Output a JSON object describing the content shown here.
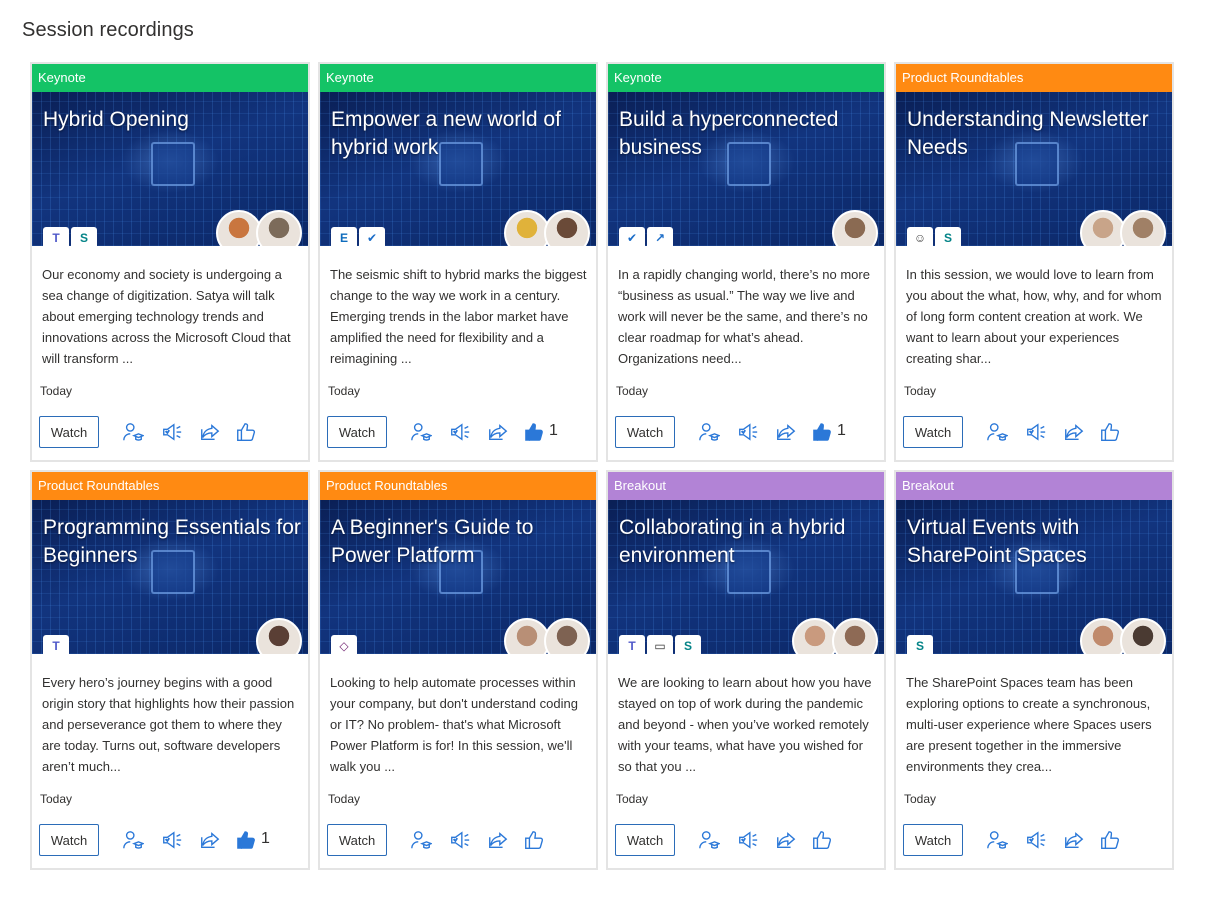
{
  "page": {
    "title": "Session recordings"
  },
  "colors": {
    "keynote": "#14c366",
    "product_roundtables": "#ff8a12",
    "breakout": "#b283d6",
    "action_icon": "#2b78d8"
  },
  "cards": [
    {
      "category": "Keynote",
      "category_color": "#14c366",
      "title": "Hybrid Opening",
      "apps": [
        {
          "icon": "teams-icon",
          "glyph": "T",
          "color": "#5059c9"
        },
        {
          "icon": "sharepoint-icon",
          "glyph": "S",
          "color": "#038387"
        }
      ],
      "avatars": [
        {
          "icon": "speaker-avatar",
          "color": "#c9763f"
        },
        {
          "icon": "speaker-avatar",
          "color": "#7c6b5a"
        }
      ],
      "description": "Our economy and society is undergoing a sea change of digitization. Satya will talk about emerging technology trends and innovations across the Microsoft Cloud that will transform ...",
      "date": "Today",
      "watch_label": "Watch",
      "liked": false,
      "like_count": ""
    },
    {
      "category": "Keynote",
      "category_color": "#14c366",
      "title": "Empower a new world of hybrid work",
      "apps": [
        {
          "icon": "exchange-icon",
          "glyph": "E",
          "color": "#0f6cbd"
        },
        {
          "icon": "planner-icon",
          "glyph": "✔",
          "color": "#1b6dc8"
        }
      ],
      "avatars": [
        {
          "icon": "speaker-avatar",
          "color": "#e0b23a"
        },
        {
          "icon": "speaker-avatar",
          "color": "#6a4a38"
        }
      ],
      "description": "The seismic shift to hybrid marks the biggest change to the way we work in a century. Emerging trends in the labor market have amplified the need for flexibility and a reimagining ...",
      "date": "Today",
      "watch_label": "Watch",
      "liked": true,
      "like_count": "1"
    },
    {
      "category": "Keynote",
      "category_color": "#14c366",
      "title": "Build a hyperconnected business",
      "apps": [
        {
          "icon": "planner-icon",
          "glyph": "✔",
          "color": "#1b6dc8"
        },
        {
          "icon": "analytics-icon",
          "glyph": "↗",
          "color": "#1b6dc8"
        }
      ],
      "avatars": [
        {
          "icon": "speaker-avatar",
          "color": "#8a6a52"
        }
      ],
      "description": "In a rapidly changing world, there’s no more “business as usual.” The way we live and work will never be the same, and there’s no clear roadmap for what’s ahead. Organizations need...",
      "date": "Today",
      "watch_label": "Watch",
      "liked": true,
      "like_count": "1"
    },
    {
      "category": "Product Roundtables",
      "category_color": "#ff8a12",
      "title": "Understanding Newsletter Needs",
      "apps": [
        {
          "icon": "community-icon",
          "glyph": "☺",
          "color": "#444444"
        },
        {
          "icon": "sharepoint-icon",
          "glyph": "S",
          "color": "#038387"
        }
      ],
      "avatars": [
        {
          "icon": "speaker-avatar",
          "color": "#c8a489"
        },
        {
          "icon": "speaker-avatar",
          "color": "#a08066"
        }
      ],
      "description": "In this session, we would love to learn from you about the what, how, why, and for whom of long form content creation at work. We want to learn about your experiences creating shar...",
      "date": "Today",
      "watch_label": "Watch",
      "liked": false,
      "like_count": ""
    },
    {
      "category": "Product Roundtables",
      "category_color": "#ff8a12",
      "title": "Programming Essentials for Beginners",
      "apps": [
        {
          "icon": "teams-icon",
          "glyph": "T",
          "color": "#5059c9"
        }
      ],
      "avatars": [
        {
          "icon": "speaker-avatar",
          "color": "#5a3f35"
        }
      ],
      "description": "Every hero’s journey begins with a good origin story that highlights how their passion and perseverance got them to where they are today. Turns out, software developers aren’t much...",
      "date": "Today",
      "watch_label": "Watch",
      "liked": true,
      "like_count": "1"
    },
    {
      "category": "Product Roundtables",
      "category_color": "#ff8a12",
      "title": "A Beginner's Guide to Power Platform",
      "apps": [
        {
          "icon": "power-platform-icon",
          "glyph": "◇",
          "color": "#742774"
        }
      ],
      "avatars": [
        {
          "icon": "speaker-avatar",
          "color": "#b88f76"
        },
        {
          "icon": "speaker-avatar",
          "color": "#7e6252"
        }
      ],
      "description": "Looking to help automate processes within your company, but don't understand coding or IT? No problem- that's what Microsoft Power Platform is for! In this session, we'll walk you ...",
      "date": "Today",
      "watch_label": "Watch",
      "liked": false,
      "like_count": ""
    },
    {
      "category": "Breakout",
      "category_color": "#b283d6",
      "title": "Collaborating in a hybrid environment",
      "apps": [
        {
          "icon": "teams-icon",
          "glyph": "T",
          "color": "#5059c9"
        },
        {
          "icon": "whiteboard-icon",
          "glyph": "▭",
          "color": "#333333"
        },
        {
          "icon": "sharepoint-icon",
          "glyph": "S",
          "color": "#038387"
        }
      ],
      "avatars": [
        {
          "icon": "speaker-avatar",
          "color": "#c99a7e"
        },
        {
          "icon": "speaker-avatar",
          "color": "#8e6a55"
        }
      ],
      "description": "We are looking to learn about how you have stayed on top of work during the pandemic and beyond - when you’ve worked remotely with your teams, what have you wished for so that you ...",
      "date": "Today",
      "watch_label": "Watch",
      "liked": false,
      "like_count": ""
    },
    {
      "category": "Breakout",
      "category_color": "#b283d6",
      "title": "Virtual Events with SharePoint Spaces",
      "apps": [
        {
          "icon": "sharepoint-icon",
          "glyph": "S",
          "color": "#038387"
        }
      ],
      "avatars": [
        {
          "icon": "speaker-avatar",
          "color": "#c08a6c"
        },
        {
          "icon": "speaker-avatar",
          "color": "#4a3a32"
        }
      ],
      "description": "The SharePoint Spaces team has been exploring options to create a synchronous, multi-user experience where Spaces users are present together in the immersive environments they crea...",
      "date": "Today",
      "watch_label": "Watch",
      "liked": false,
      "like_count": ""
    }
  ]
}
